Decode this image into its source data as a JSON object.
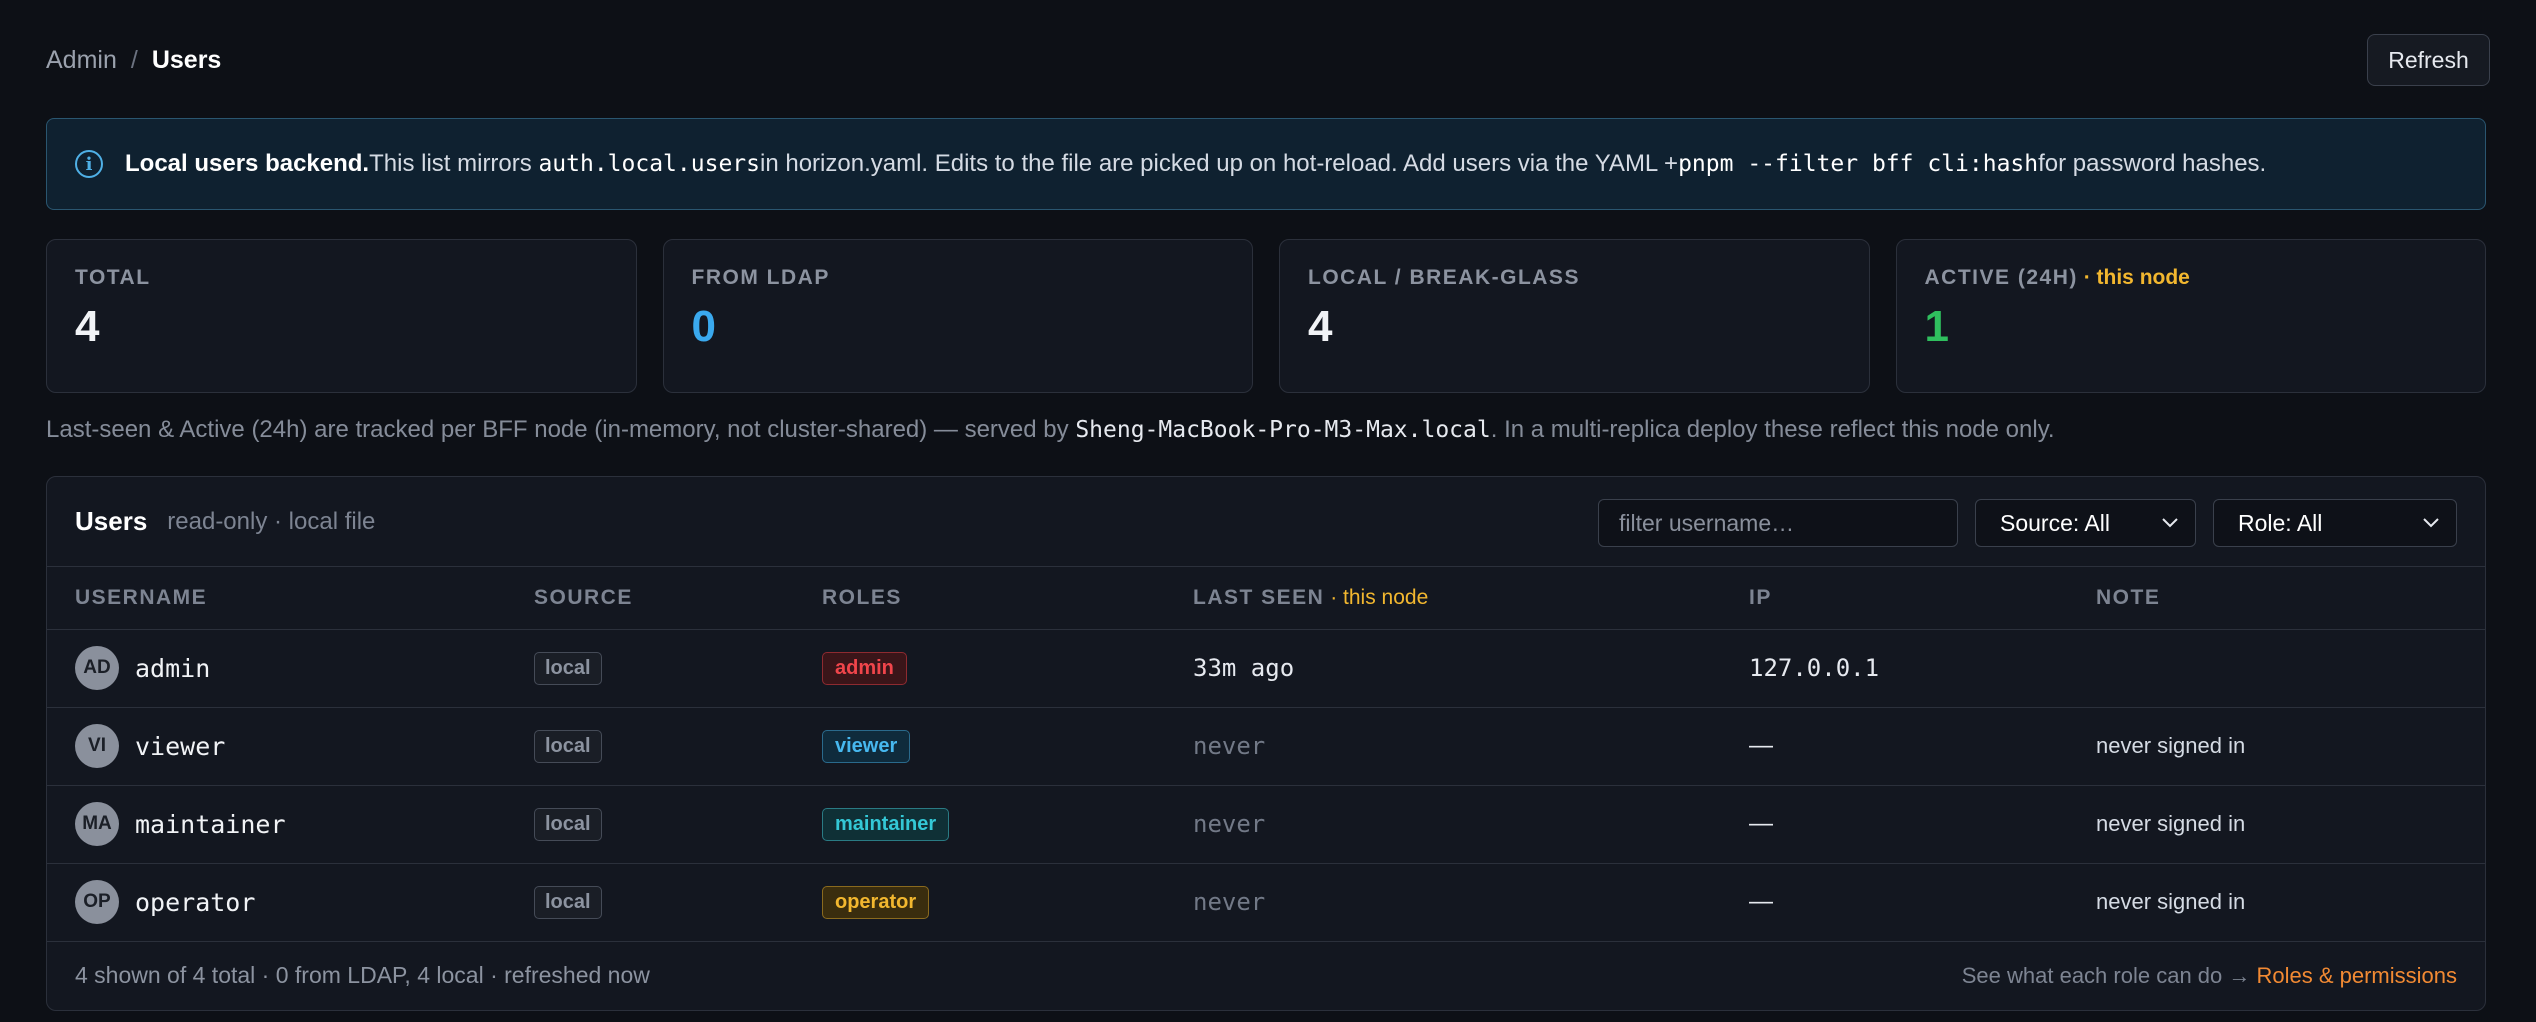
{
  "breadcrumb": {
    "root": "Admin",
    "separator": "/",
    "current": "Users"
  },
  "header": {
    "refresh_label": "Refresh"
  },
  "banner": {
    "icon": "info-icon",
    "title": "Local users backend.",
    "text1": "This list mirrors ",
    "code1": "auth.local.users",
    "text2": " in horizon.yaml. Edits to the file are picked up on hot-reload. Add users via the YAML + ",
    "code2": "pnpm --filter bff cli:hash",
    "text3": " for password hashes."
  },
  "stats": [
    {
      "label": "TOTAL",
      "value": "4",
      "accent": ""
    },
    {
      "label": "FROM LDAP",
      "value": "0",
      "accent": ""
    },
    {
      "label": "LOCAL / BREAK-GLASS",
      "value": "4",
      "accent": ""
    },
    {
      "label": "ACTIVE (24H)",
      "value": "1",
      "accent": " · this node"
    }
  ],
  "note": {
    "prefix": "Last-seen & Active (24h) are tracked per BFF node (in-memory, not cluster-shared) — served by ",
    "host": "Sheng-MacBook-Pro-M3-Max.local",
    "suffix": ". In a multi-replica deploy these reflect this node only."
  },
  "panel": {
    "title": "Users",
    "subtitle": "read-only · local file",
    "filter_placeholder": "filter username…",
    "source_select": "Source: All",
    "role_select": "Role: All"
  },
  "columns": {
    "username": "USERNAME",
    "source": "SOURCE",
    "roles": "ROLES",
    "last_seen": "LAST SEEN",
    "last_seen_accent": " · this node",
    "ip": "IP",
    "note": "NOTE"
  },
  "rows": [
    {
      "initials": "AD",
      "username": "admin",
      "source": "local",
      "role": "admin",
      "last_seen": "33m ago",
      "ip": "127.0.0.1",
      "note": ""
    },
    {
      "initials": "VI",
      "username": "viewer",
      "source": "local",
      "role": "viewer",
      "last_seen": "never",
      "ip": "—",
      "note": "never signed in"
    },
    {
      "initials": "MA",
      "username": "maintainer",
      "source": "local",
      "role": "maintainer",
      "last_seen": "never",
      "ip": "—",
      "note": "never signed in"
    },
    {
      "initials": "OP",
      "username": "operator",
      "source": "local",
      "role": "operator",
      "last_seen": "never",
      "ip": "—",
      "note": "never signed in"
    }
  ],
  "footer": {
    "summary": "4 shown of 4 total · 0 from LDAP, 4 local · refreshed now",
    "hint": "See what each role can do → ",
    "link": "Roles & permissions"
  },
  "colors": {
    "accent_yellow": "#f2b72f",
    "ldap_blue": "#3aa9ee",
    "active_green": "#2fbf5e",
    "link_orange": "#f28a33"
  }
}
